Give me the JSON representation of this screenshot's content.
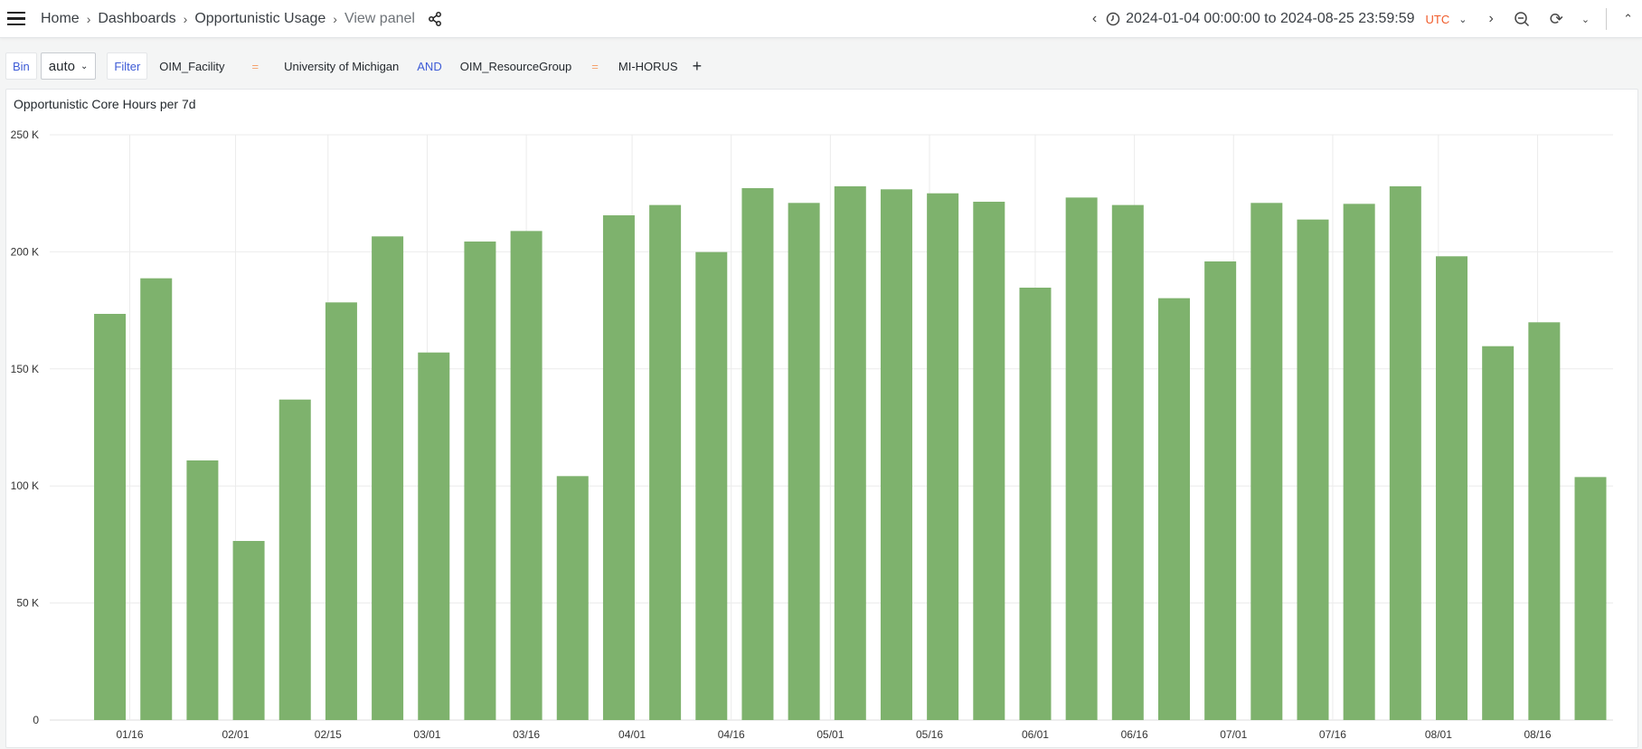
{
  "header": {
    "breadcrumb": [
      "Home",
      "Dashboards",
      "Opportunistic Usage",
      "View panel"
    ],
    "time_range": "2024-01-04 00:00:00 to 2024-08-25 23:59:59",
    "timezone": "UTC"
  },
  "filters": {
    "bin_label": "Bin",
    "bin_value": "auto",
    "filter_label": "Filter",
    "key1": "OIM_Facility",
    "op1": "=",
    "val1": "University of Michigan",
    "conj": "AND",
    "key2": "OIM_ResourceGroup",
    "op2": "=",
    "val2": "MI-HORUS"
  },
  "panel": {
    "title": "Opportunistic Core Hours per 7d"
  },
  "colors": {
    "bar": "#7eb26d",
    "accent": "#3d5bd6",
    "timezone": "#f05a28"
  },
  "chart_data": {
    "type": "bar",
    "title": "Opportunistic Core Hours per 7d",
    "ylim": [
      0,
      250000
    ],
    "grid": true,
    "yticks": [
      0,
      50000,
      100000,
      150000,
      200000,
      250000
    ],
    "ytick_labels": [
      "0",
      "50 K",
      "100 K",
      "150 K",
      "200 K",
      "250 K"
    ],
    "xtick_labels": [
      "01/16",
      "02/01",
      "02/15",
      "03/01",
      "03/16",
      "04/01",
      "04/16",
      "05/01",
      "05/16",
      "06/01",
      "06/16",
      "07/01",
      "07/16",
      "08/01",
      "08/16"
    ],
    "xtick_dates": [
      "2024-01-16",
      "2024-02-01",
      "2024-02-15",
      "2024-03-01",
      "2024-03-16",
      "2024-04-01",
      "2024-04-16",
      "2024-05-01",
      "2024-05-16",
      "2024-06-01",
      "2024-06-16",
      "2024-07-01",
      "2024-07-16",
      "2024-08-01",
      "2024-08-16"
    ],
    "x": [
      "2024-01-13",
      "2024-01-20",
      "2024-01-27",
      "2024-02-03",
      "2024-02-10",
      "2024-02-17",
      "2024-02-24",
      "2024-03-02",
      "2024-03-09",
      "2024-03-16",
      "2024-03-23",
      "2024-03-30",
      "2024-04-06",
      "2024-04-13",
      "2024-04-20",
      "2024-04-27",
      "2024-05-04",
      "2024-05-11",
      "2024-05-18",
      "2024-05-25",
      "2024-06-01",
      "2024-06-08",
      "2024-06-15",
      "2024-06-22",
      "2024-06-29",
      "2024-07-06",
      "2024-07-13",
      "2024-07-20",
      "2024-07-27",
      "2024-08-03",
      "2024-08-10",
      "2024-08-17",
      "2024-08-24"
    ],
    "values": [
      173500,
      188700,
      110900,
      76500,
      136900,
      178400,
      206600,
      157000,
      204400,
      208900,
      104200,
      215600,
      220000,
      199900,
      227200,
      220900,
      228000,
      226700,
      225000,
      221400,
      184700,
      223200,
      220000,
      180200,
      195900,
      220900,
      213800,
      220500,
      228000,
      198100,
      159700,
      169900,
      103800
    ]
  }
}
